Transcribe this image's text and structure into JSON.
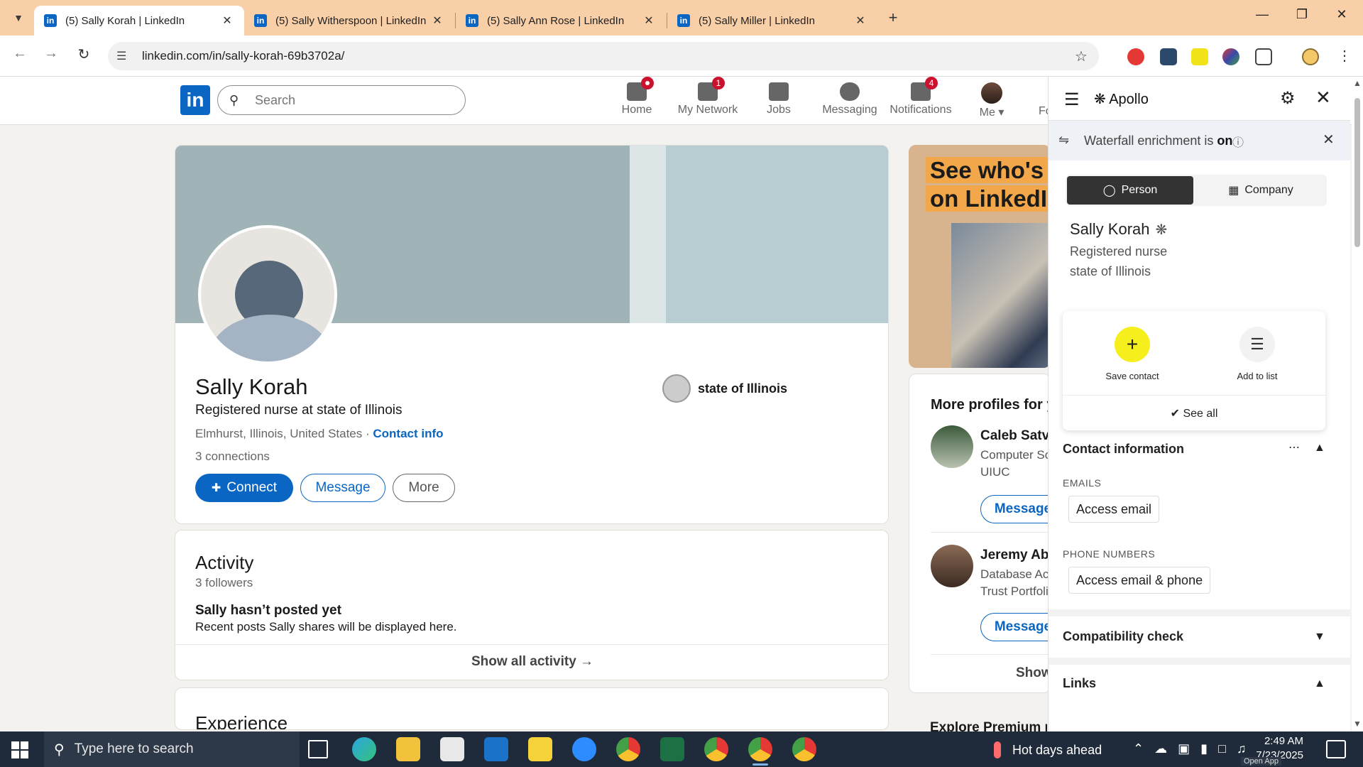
{
  "browser": {
    "tabs": [
      {
        "title": "(5) Sally Korah | LinkedIn",
        "active": true
      },
      {
        "title": "(5) Sally Witherspoon | LinkedIn",
        "active": false
      },
      {
        "title": "(5) Sally Ann Rose | LinkedIn",
        "active": false
      },
      {
        "title": "(5) Sally Miller | LinkedIn",
        "active": false
      }
    ],
    "favicon_letters": "in",
    "new_tab_label": "+",
    "url": "linkedin.com/in/sally-korah-69b3702a/",
    "tabstrip_color": "#f9cfa8"
  },
  "linkedin": {
    "logo": "in",
    "search_placeholder": "Search",
    "nav": [
      {
        "label": "Home",
        "badge": ""
      },
      {
        "label": "My Network",
        "badge": "1"
      },
      {
        "label": "Jobs",
        "badge": ""
      },
      {
        "label": "Messaging",
        "badge": ""
      },
      {
        "label": "Notifications",
        "badge": "4"
      },
      {
        "label": "Me",
        "badge": ""
      }
    ],
    "nav_overflow": "Fo",
    "accent": "#0a66c2"
  },
  "profile": {
    "name": "Sally Korah",
    "headline": "Registered nurse at state of Illinois",
    "location": "Elmhurst, Illinois, United States",
    "location_sep": " · ",
    "contact_info": "Contact info",
    "connections": "3 connections",
    "organization": "state of Illinois",
    "buttons": {
      "connect": "Connect",
      "message": "Message",
      "more": "More"
    }
  },
  "activity": {
    "title": "Activity",
    "followers": "3 followers",
    "empty_title": "Sally hasn’t posted yet",
    "empty_sub": "Recent posts Sally shares will be displayed here.",
    "show_all": "Show all activity →"
  },
  "experience": {
    "title": "Experience"
  },
  "right_rail": {
    "ad_line1": "See who's hir",
    "ad_line2": "on LinkedIn.",
    "more_profiles_title": "More profiles for y",
    "people": [
      {
        "name": "Caleb Satv",
        "line1": "Computer Sc",
        "line2": "UIUC",
        "button": "Message"
      },
      {
        "name": "Jeremy Ab",
        "line1": "Database Ac",
        "line2": "Trust Portfoli",
        "button": "Message"
      }
    ],
    "show_more": "Show",
    "explore": "Explore Premium p"
  },
  "apollo": {
    "title": "Apollo",
    "waterfall_prefix": "Waterfall enrichment is ",
    "waterfall_state": "on",
    "toggle": {
      "person": "Person",
      "company": "Company"
    },
    "contact_name": "Sally Korah",
    "contact_title": "Registered nurse",
    "contact_org": "state of Illinois",
    "actions": {
      "save": "Save contact",
      "add_list": "Add to list",
      "see_all": "See all"
    },
    "contact_info_title": "Contact information",
    "emails_label": "EMAILS",
    "access_email": "Access email",
    "phone_label": "PHONE NUMBERS",
    "access_email_phone": "Access email & phone",
    "compatibility_title": "Compatibility check",
    "links_title": "Links",
    "save_color": "#f6ef1e"
  },
  "taskbar": {
    "search_placeholder": "Type here to search",
    "weather": "Hot days ahead",
    "time": "2:49 AM",
    "date": "7/23/2025",
    "open_app": "Open App"
  }
}
